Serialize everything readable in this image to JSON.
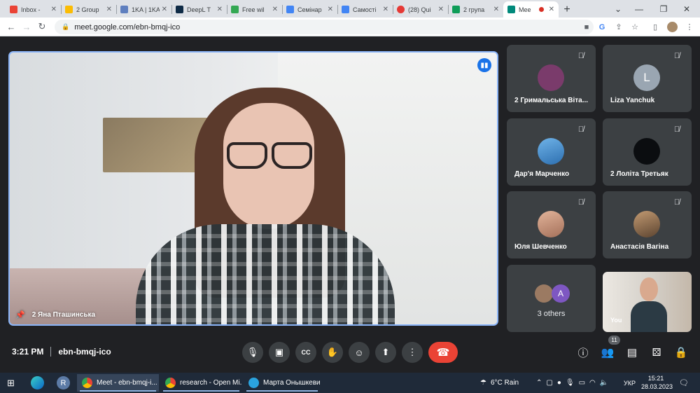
{
  "browser": {
    "tabs": [
      {
        "label": "Inbox - ",
        "color": "#ea4335"
      },
      {
        "label": "2 Group",
        "color": "#fbbc04"
      },
      {
        "label": "1KA | 1KA",
        "color": "#5f7fbf"
      },
      {
        "label": "DeepL T",
        "color": "#0f2b46"
      },
      {
        "label": "Free wil",
        "color": "#34a853"
      },
      {
        "label": "Семінар",
        "color": "#4285f4"
      },
      {
        "label": "Самості",
        "color": "#4285f4"
      },
      {
        "label": "(28) Qui",
        "color": "#e53935"
      },
      {
        "label": "2 група",
        "color": "#0f9d58"
      },
      {
        "label": "Mee",
        "color": "#00897b"
      }
    ],
    "new_tab": "+",
    "url": "meet.google.com/ebn-bmqj-ico"
  },
  "meet": {
    "main_speaker": "2 Яна Пташинська",
    "participants": [
      {
        "name": "2 Гримальська Віта...",
        "avatar_letter": "",
        "avatar_color": "#7a3b6b"
      },
      {
        "name": "Liza Yanchuk",
        "avatar_letter": "L",
        "avatar_color": "#9aa6b2"
      },
      {
        "name": "Дар'я Марченко",
        "avatar_letter": "",
        "avatar_color": "#3d8fd0"
      },
      {
        "name": "2 Лоліта Третьяк",
        "avatar_letter": "",
        "avatar_color": "#0b0d10"
      },
      {
        "name": "Юля Шевченко",
        "avatar_letter": "",
        "avatar_color": "#c98f78"
      },
      {
        "name": "Анастасія Вагіна",
        "avatar_letter": "",
        "avatar_color": "#8a6a4c"
      }
    ],
    "others": {
      "label": "3 others",
      "avatar_letter": "A",
      "avatar_color": "#7e57c2"
    },
    "self_label": "You",
    "time": "3:21 PM",
    "meeting_code": "ebn-bmqj-ico",
    "people_count": "11",
    "end_call_color": "#ea4335"
  },
  "taskbar": {
    "apps": [
      {
        "label": "Meet - ebn-bmqj-i...",
        "active": true
      },
      {
        "label": "research - Open Mi...",
        "active": false
      },
      {
        "label": "Марта Онышкеви...",
        "active": false
      }
    ],
    "weather": "6°C  Rain",
    "language": "УКР",
    "time": "15:21",
    "date": "28.03.2023"
  }
}
